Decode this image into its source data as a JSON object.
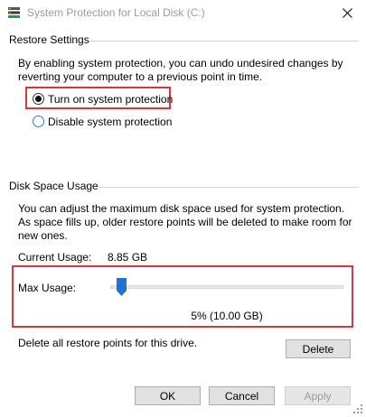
{
  "window": {
    "title": "System Protection for Local Disk (C:)"
  },
  "restore_settings": {
    "group_label": "Restore Settings",
    "description": "By enabling system protection, you can undo undesired changes by reverting your computer to a previous point in time.",
    "options": [
      {
        "label": "Turn on system protection",
        "selected": true
      },
      {
        "label": "Disable system protection",
        "selected": false
      }
    ]
  },
  "disk_space": {
    "group_label": "Disk Space Usage",
    "description": "You can adjust the maximum disk space used for system protection. As space fills up, older restore points will be deleted to make room for new ones.",
    "current_usage_label": "Current Usage:",
    "current_usage_value": "8.85 GB",
    "max_usage_label": "Max Usage:",
    "max_usage_percent_text": "5% (10.00 GB)",
    "max_usage_fraction": 0.05,
    "delete_description": "Delete all restore points for this drive.",
    "delete_label": "Delete"
  },
  "footer": {
    "ok_label": "OK",
    "cancel_label": "Cancel",
    "apply_label": "Apply"
  },
  "colors": {
    "highlight": "#e0333a",
    "radio_accent": "#3b7bbf",
    "slider_thumb": "#1f73d1"
  }
}
